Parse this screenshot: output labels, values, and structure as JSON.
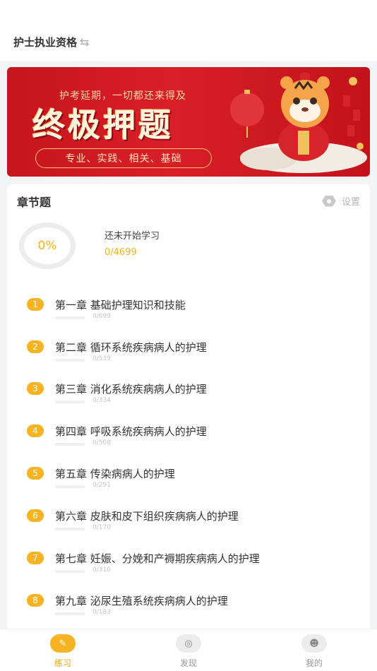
{
  "header": {
    "title": "护士执业资格",
    "swap_icon": "swap-arrows-icon"
  },
  "banner": {
    "subtitle": "护考延期，一切都还来得及",
    "title": "终极押题",
    "tags": "专业、实践、相关、基础"
  },
  "chapters_card": {
    "title": "章节题",
    "settings_label": "设置",
    "progress": {
      "percent_text": "0%",
      "status": "还未开始学习",
      "count": "0/4699"
    },
    "items": [
      {
        "num": "1",
        "title": "第一章 基础护理知识和技能",
        "count": "0/699"
      },
      {
        "num": "2",
        "title": "第二章 循环系统疾病病人的护理",
        "count": "0/539"
      },
      {
        "num": "3",
        "title": "第三章 消化系统疾病病人的护理",
        "count": "0/334"
      },
      {
        "num": "4",
        "title": "第四章 呼吸系统疾病病人的护理",
        "count": "0/508"
      },
      {
        "num": "5",
        "title": "第五章 传染病病人的护理",
        "count": "0/291"
      },
      {
        "num": "6",
        "title": "第六章 皮肤和皮下组织疾病病人的护理",
        "count": "0/170"
      },
      {
        "num": "7",
        "title": "第七章 妊娠、分娩和产褥期疾病病人的护理",
        "count": "0/310"
      },
      {
        "num": "8",
        "title": "第九章 泌尿生殖系统疾病病人的护理",
        "count": "0/183"
      }
    ]
  },
  "tabbar": {
    "items": [
      {
        "label": "练习",
        "icon": "pencil-icon",
        "active": true
      },
      {
        "label": "发现",
        "icon": "discover-icon",
        "active": false
      },
      {
        "label": "我的",
        "icon": "profile-icon",
        "active": false
      }
    ]
  },
  "colors": {
    "accent": "#f7b321",
    "banner_red": "#d81f26"
  }
}
